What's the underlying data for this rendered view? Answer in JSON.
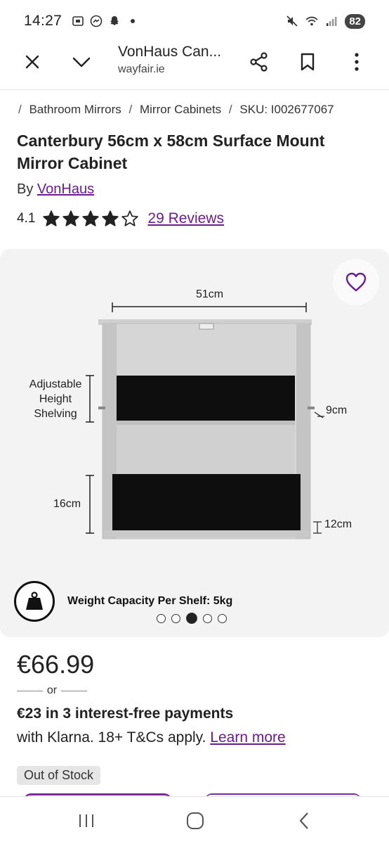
{
  "status_bar": {
    "time": "14:27",
    "battery": "82"
  },
  "browser": {
    "title": "VonHaus Can...",
    "url": "wayfair.ie"
  },
  "breadcrumb": [
    "Bathroom Mirrors",
    "Mirror Cabinets",
    "SKU: I002677067"
  ],
  "product": {
    "title": "Canterbury 56cm x 58cm Surface Mount Mirror Cabinet",
    "by_label": "By",
    "brand": "VonHaus",
    "rating": "4.1",
    "stars_filled": 4,
    "stars_total": 5,
    "reviews_link": "29 Reviews"
  },
  "gallery": {
    "dim_width": "51cm",
    "dim_shelving": "Adjustable\nHeight\nShelving",
    "dim_9": "9cm",
    "dim_16": "16cm",
    "dim_12": "12cm",
    "caption": "Weight Capacity Per Shelf: 5kg",
    "image_count": 5,
    "active_index": 2
  },
  "pricing": {
    "price": "€66.99",
    "or": "or",
    "klarna_line": "€23 in 3 interest-free payments",
    "klarna_sub": "with Klarna. 18+ T&Cs apply.",
    "learn_more": "Learn more",
    "stock": "Out of Stock"
  },
  "colors": {
    "accent": "#6b1c8f"
  }
}
